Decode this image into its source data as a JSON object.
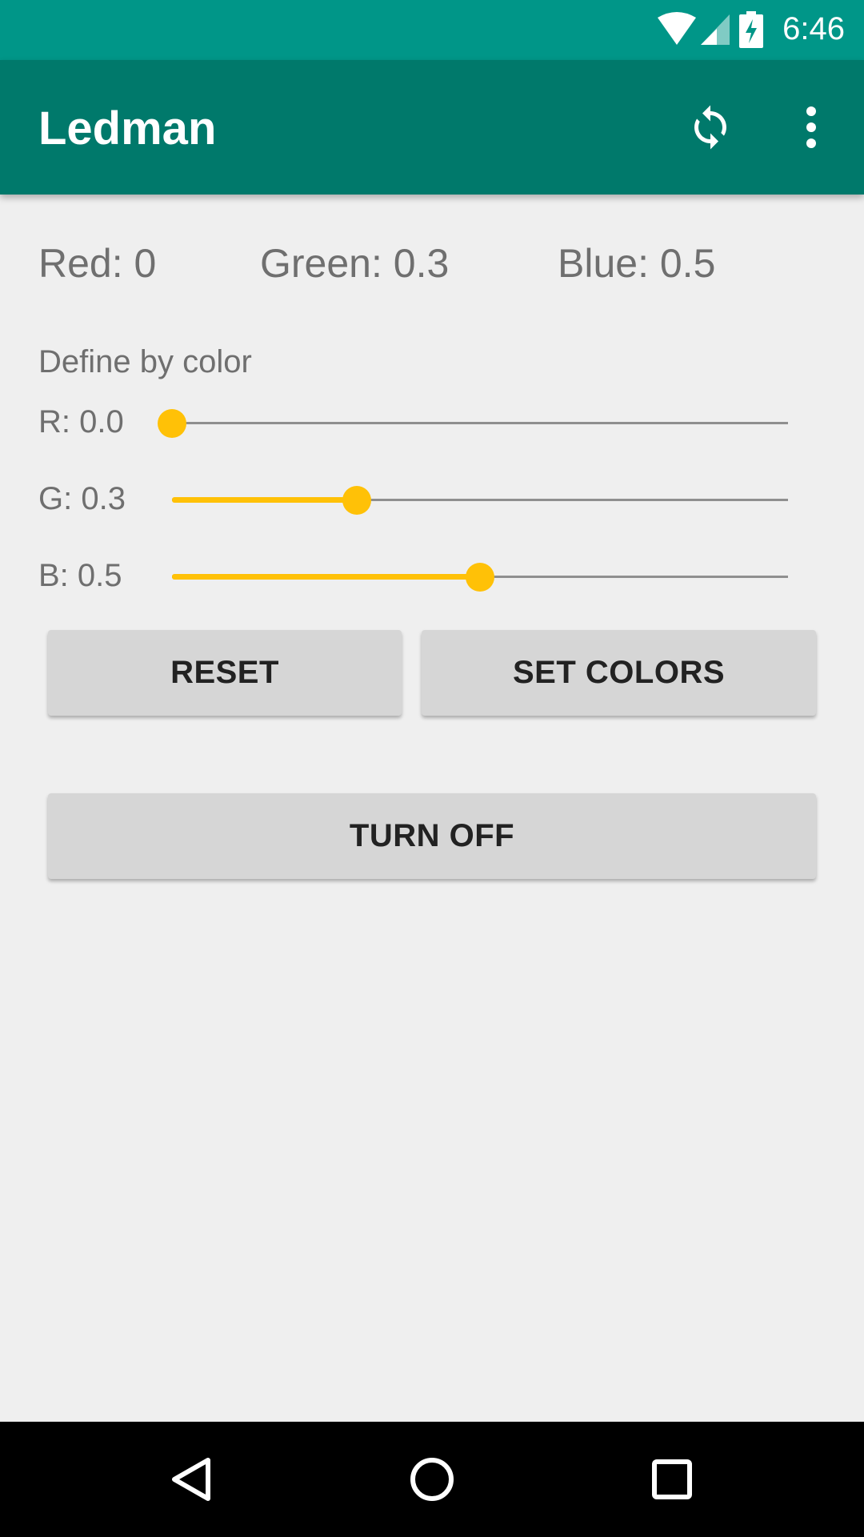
{
  "status_bar": {
    "time": "6:46",
    "icons": [
      "wifi-icon",
      "signal-icon",
      "battery-charging-icon"
    ]
  },
  "app_bar": {
    "title": "Ledman",
    "actions": [
      "sync-icon",
      "more-vert-icon"
    ]
  },
  "rgb_summary": {
    "red": {
      "label": "Red:",
      "value": "0"
    },
    "green": {
      "label": "Green:",
      "value": "0.3"
    },
    "blue": {
      "label": "Blue:",
      "value": "0.5"
    }
  },
  "section_title": "Define by color",
  "sliders": [
    {
      "label": "R:",
      "value_text": "0.0",
      "value": 0.0
    },
    {
      "label": "G:",
      "value_text": "0.3",
      "value": 0.3
    },
    {
      "label": "B:",
      "value_text": "0.5",
      "value": 0.5
    }
  ],
  "buttons": {
    "reset": "RESET",
    "set_colors": "SET COLORS",
    "turn_off": "TURN OFF"
  },
  "nav_bar": {
    "icons": [
      "back-icon",
      "home-icon",
      "recents-icon"
    ]
  },
  "colors": {
    "status_bar": "#009688",
    "app_bar": "#00796b",
    "accent": "#ffc107",
    "background": "#efefef",
    "button": "#d6d6d6"
  }
}
